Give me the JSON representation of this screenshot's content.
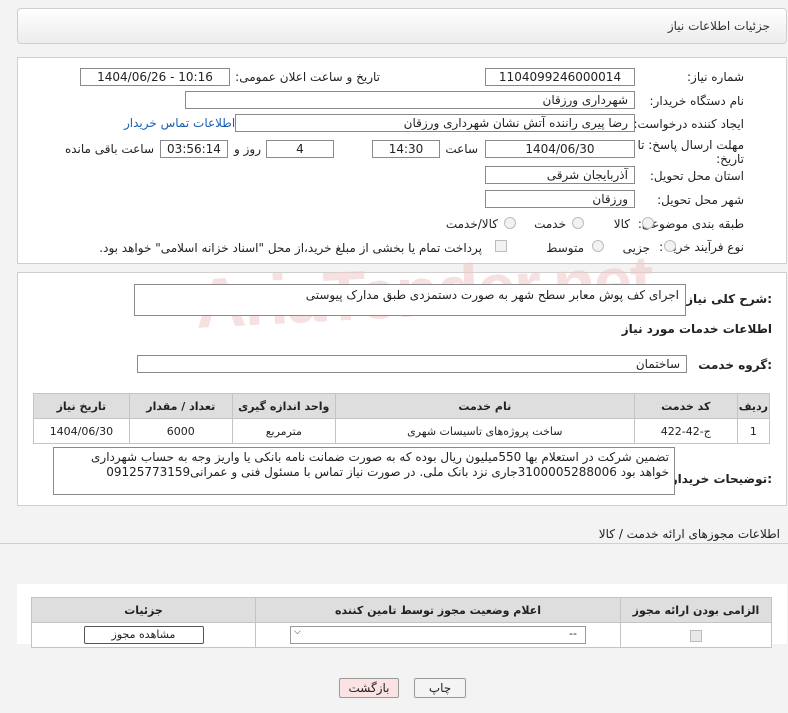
{
  "header": {
    "title": "جزئیات اطلاعات نیاز"
  },
  "fields": {
    "need_number_label": "شماره نیاز:",
    "need_number": "1104099246000014",
    "announce_label": "تاریخ و ساعت اعلان عمومی:",
    "announce_value": "1404/06/26 - 10:16",
    "buyer_org_label": "نام دستگاه خریدار:",
    "buyer_org": "شهرداری ورزقان",
    "requester_label": "ایجاد کننده درخواست:",
    "requester": "رضا پیری راننده آتش نشان شهرداری ورزقان",
    "contact_link": "اطلاعات تماس خریدار",
    "deadline_label_1": "مهلت ارسال پاسخ: تا",
    "deadline_label_2": "تاریخ:",
    "deadline_date": "1404/06/30",
    "time_label": "ساعت",
    "deadline_time": "14:30",
    "days_value": "4",
    "days_label": "روز و",
    "remaining_time": "03:56:14",
    "remaining_label": "ساعت باقی مانده",
    "province_label": "استان محل تحویل:",
    "province": "آذربایجان شرقی",
    "city_label": "شهر محل تحویل:",
    "city": "ورزقان",
    "category_label": "طبقه بندی موضوعی:",
    "category_options": [
      "کالا",
      "خدمت",
      "کالا/خدمت"
    ],
    "process_label": "نوع فرآیند خرید :",
    "process_options": [
      "جزیی",
      "متوسط"
    ],
    "payment_note": "پرداخت تمام یا بخشی از مبلغ خرید،از محل \"اسناد خزانه اسلامی\" خواهد بود."
  },
  "summary": {
    "label": "شرح کلی نیاز:",
    "text": "اجرای کف پوش معابر سطح شهر به صورت دستمزدی طبق مدارک پیوستی"
  },
  "services": {
    "title": "اطلاعات خدمات مورد نیاز",
    "group_label": "گروه خدمت:",
    "group_value": "ساختمان",
    "columns": [
      "ردیف",
      "کد خدمت",
      "نام خدمت",
      "واحد اندازه گیری",
      "تعداد / مقدار",
      "تاریخ نیاز"
    ],
    "rows": [
      [
        "1",
        "ج-42-422",
        "ساخت پروژه‌های تاسیسات شهری",
        "مترمربع",
        "6000",
        "1404/06/30"
      ]
    ]
  },
  "buyer_notes": {
    "label": "توضیحات خریدار:",
    "text": "تضمین شرکت در استعلام بها 550میلیون ریال بوده که به صورت ضمانت نامه بانکی یا واریز وجه به حساب شهرداری خواهد بود 3100005288006جاری نزد بانک ملی. در صورت نیاز تماس با مسئول فنی و عمرانی09125773159"
  },
  "permits": {
    "title": "اطلاعات مجوزهای ارائه خدمت / کالا",
    "columns": [
      "الزامی بودن ارائه مجوز",
      "اعلام وضعیت مجوز توسط تامین کننده",
      "جزئیات"
    ],
    "select_value": "--",
    "view_button": "مشاهده مجوز"
  },
  "actions": {
    "print": "چاپ",
    "back": "بازگشت"
  },
  "watermark": "AriaTender.net",
  "colors": {
    "link": "#1a5fb4",
    "back_button_bg": "#fbe3e3",
    "header_bg": "#ececec"
  }
}
